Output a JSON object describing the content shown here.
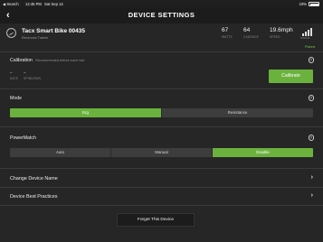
{
  "status_bar": {
    "back_app": "◀ Search",
    "time": "12:45 PM",
    "date": "Sat Sep 14",
    "battery_text": "19%",
    "wifi": "⟁"
  },
  "nav": {
    "back_icon": "‹",
    "title": "DEVICE SETTINGS"
  },
  "device": {
    "name": "Tacx Smart Bike 00435",
    "type": "Electronic Trainer",
    "metrics": [
      {
        "value": "67",
        "label": "WATTS"
      },
      {
        "value": "64",
        "label": "CADENCE"
      },
      {
        "value": "19.6mph",
        "label": "SPEED"
      }
    ],
    "signal_label": "SIGNAL",
    "status": "Paired"
  },
  "calibration": {
    "title": "Calibration",
    "subtitle": "Recommended before each ride",
    "date_value": "–",
    "date_label": "DATE",
    "spindown_value": "–",
    "spindown_label": "SPINDOWN",
    "button_label": "Calibrate"
  },
  "mode": {
    "title": "Mode",
    "options": [
      "Erg",
      "Resistance"
    ],
    "selected": 0
  },
  "powermatch": {
    "title": "PowerMatch",
    "options": [
      "Auto",
      "Manual",
      "Disable"
    ],
    "selected": 2
  },
  "links": {
    "change_name": "Change Device Name",
    "best_practices": "Device Best Practices"
  },
  "forget_button": "Forget This Device",
  "colors": {
    "accent": "#6ab23d",
    "paired": "#7cc242",
    "background": "#262626"
  }
}
